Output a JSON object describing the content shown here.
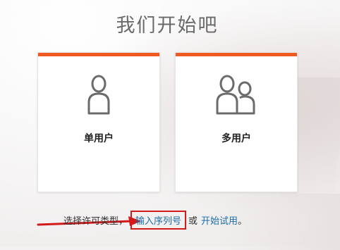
{
  "title": "我们开始吧",
  "cards": [
    {
      "label": "单用户",
      "icon": "single-user-icon"
    },
    {
      "label": "多用户",
      "icon": "multi-user-icon"
    }
  ],
  "footer": {
    "prompt": "选择许可类型，",
    "serial_link": "输入序列号",
    "or": "或",
    "trial_link": "开始试用",
    "period": "。"
  },
  "colors": {
    "accent": "#f05a22",
    "link": "#1c6ea8",
    "highlight": "#d21a1a"
  }
}
